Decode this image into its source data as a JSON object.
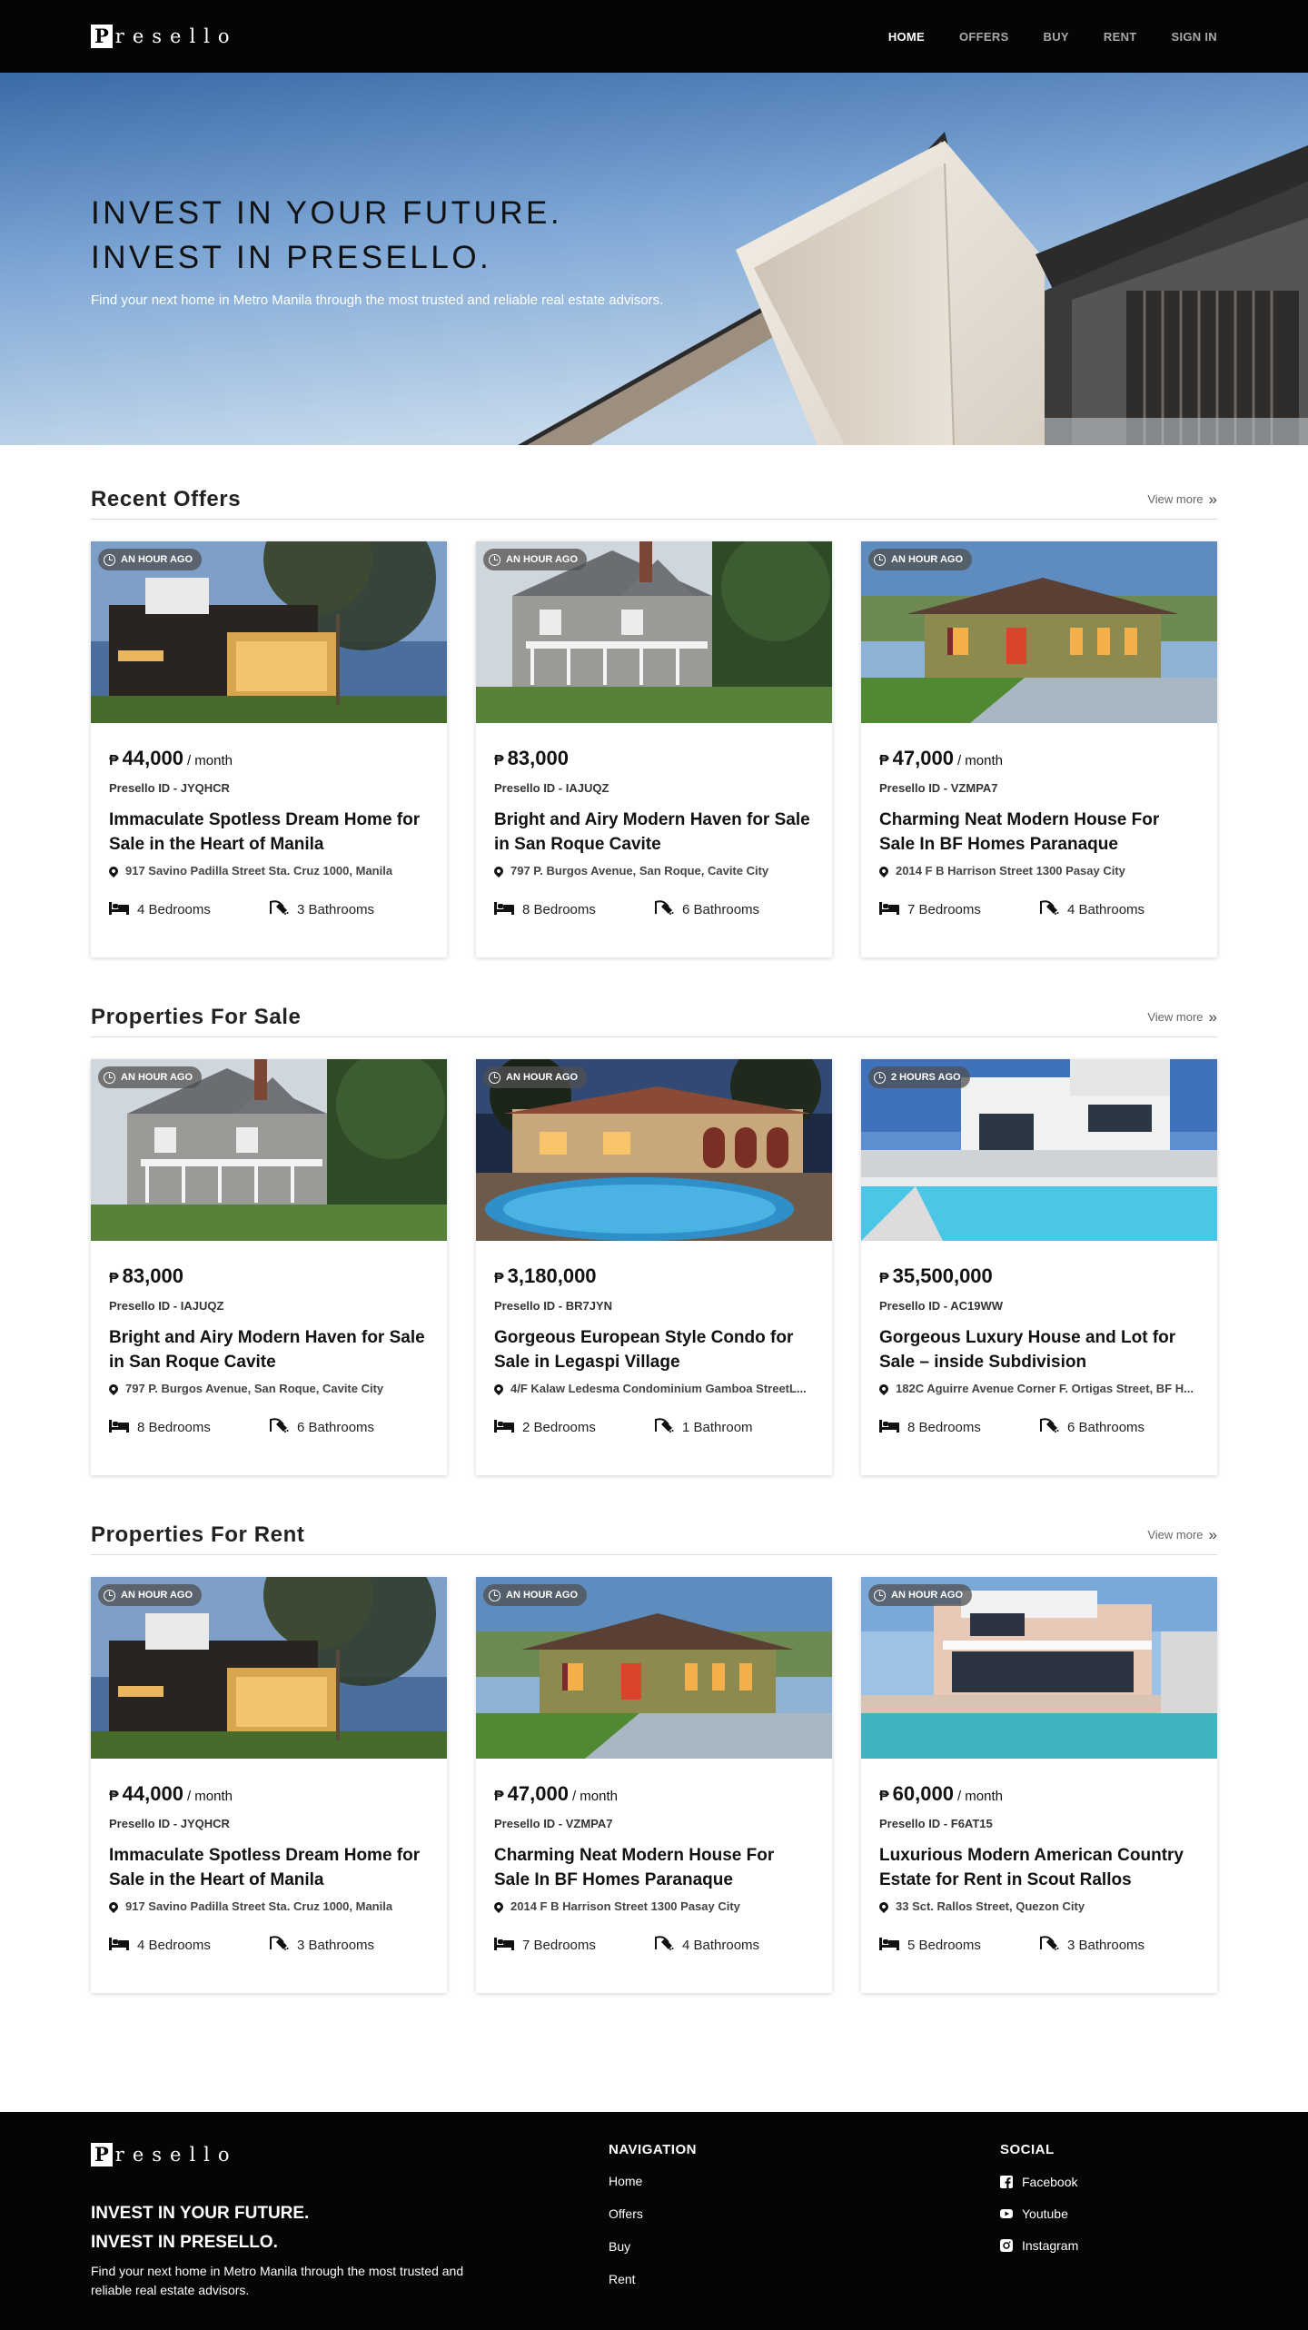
{
  "brand": {
    "logo_initial": "P",
    "logo_rest": "resello"
  },
  "nav": {
    "links": [
      "HOME",
      "OFFERS",
      "BUY",
      "RENT",
      "SIGN IN"
    ]
  },
  "hero": {
    "title_line1": "INVEST IN YOUR FUTURE.",
    "title_line2": "INVEST IN PRESELLO.",
    "subtitle": "Find your next home in Metro Manila through the most trusted and reliable real estate advisors."
  },
  "currency_symbol": "₱",
  "sections": [
    {
      "title": "Recent Offers",
      "view_more": "View more",
      "cards": [
        {
          "badge": "AN HOUR AGO",
          "price": "44,000",
          "per": "/ month",
          "pid": "Presello ID - JYQHCR",
          "title": "Immaculate Spotless Dream Home for Sale in the Heart of Manila",
          "address": "917 Savino Padilla Street Sta. Cruz 1000, Manila",
          "bedrooms": "4 Bedrooms",
          "bathrooms": "3 Bathrooms",
          "img": "modern-dark"
        },
        {
          "badge": "AN HOUR AGO",
          "price": "83,000",
          "per": "",
          "pid": "Presello ID - IAJUQZ",
          "title": "Bright and Airy Modern Haven for Sale in San Roque Cavite",
          "address": "797 P. Burgos Avenue, San Roque, Cavite City",
          "bedrooms": "8 Bedrooms",
          "bathrooms": "6 Bathrooms",
          "img": "victorian"
        },
        {
          "badge": "AN HOUR AGO",
          "price": "47,000",
          "per": "/ month",
          "pid": "Presello ID - VZMPA7",
          "title": "Charming Neat Modern House For Sale In BF Homes Paranaque",
          "address": "2014 F B Harrison Street 1300 Pasay City",
          "bedrooms": "7 Bedrooms",
          "bathrooms": "4 Bathrooms",
          "img": "bungalow"
        }
      ]
    },
    {
      "title": "Properties For Sale",
      "view_more": "View more",
      "cards": [
        {
          "badge": "AN HOUR AGO",
          "price": "83,000",
          "per": "",
          "pid": "Presello ID - IAJUQZ",
          "title": "Bright and Airy Modern Haven for Sale in San Roque Cavite",
          "address": "797 P. Burgos Avenue, San Roque, Cavite City",
          "bedrooms": "8 Bedrooms",
          "bathrooms": "6 Bathrooms",
          "img": "victorian"
        },
        {
          "badge": "AN HOUR AGO",
          "price": "3,180,000",
          "per": "",
          "pid": "Presello ID - BR7JYN",
          "title": "Gorgeous European Style Condo for Sale in Legaspi Village",
          "address": "4/F Kalaw Ledesma Condominium Gamboa StreetL...",
          "bedrooms": "2 Bedrooms",
          "bathrooms": "1 Bathroom",
          "img": "pool-night"
        },
        {
          "badge": "2 HOURS AGO",
          "price": "35,500,000",
          "per": "",
          "pid": "Presello ID - AC19WW",
          "title": "Gorgeous Luxury House and Lot for Sale – inside Subdivision",
          "address": "182C Aguirre Avenue Corner F. Ortigas Street, BF H...",
          "bedrooms": "8 Bedrooms",
          "bathrooms": "6 Bathrooms",
          "img": "white-pool"
        }
      ]
    },
    {
      "title": "Properties For Rent",
      "view_more": "View more",
      "cards": [
        {
          "badge": "AN HOUR AGO",
          "price": "44,000",
          "per": "/ month",
          "pid": "Presello ID - JYQHCR",
          "title": "Immaculate Spotless Dream Home for Sale in the Heart of Manila",
          "address": "917 Savino Padilla Street Sta. Cruz 1000, Manila",
          "bedrooms": "4 Bedrooms",
          "bathrooms": "3 Bathrooms",
          "img": "modern-dark"
        },
        {
          "badge": "AN HOUR AGO",
          "price": "47,000",
          "per": "/ month",
          "pid": "Presello ID - VZMPA7",
          "title": "Charming Neat Modern House For Sale In BF Homes Paranaque",
          "address": "2014 F B Harrison Street 1300 Pasay City",
          "bedrooms": "7 Bedrooms",
          "bathrooms": "4 Bathrooms",
          "img": "bungalow"
        },
        {
          "badge": "AN HOUR AGO",
          "price": "60,000",
          "per": "/ month",
          "pid": "Presello ID - F6AT15",
          "title": "Luxurious Modern American Country Estate for Rent in Scout Rallos",
          "address": "33 Sct. Rallos Street, Quezon City",
          "bedrooms": "5 Bedrooms",
          "bathrooms": "3 Bathrooms",
          "img": "terrace-pool"
        }
      ]
    }
  ],
  "footer": {
    "tagline_line1": "INVEST IN YOUR FUTURE.",
    "tagline_line2": "INVEST IN PRESELLO.",
    "subtitle": "Find your next home in Metro Manila through the most trusted and reliable real estate advisors.",
    "nav_heading": "NAVIGATION",
    "nav_items": [
      "Home",
      "Offers",
      "Buy",
      "Rent"
    ],
    "social_heading": "SOCIAL",
    "social_items": [
      {
        "label": "Facebook",
        "icon": "facebook-icon"
      },
      {
        "label": "Youtube",
        "icon": "youtube-icon"
      },
      {
        "label": "Instagram",
        "icon": "instagram-icon"
      }
    ]
  }
}
